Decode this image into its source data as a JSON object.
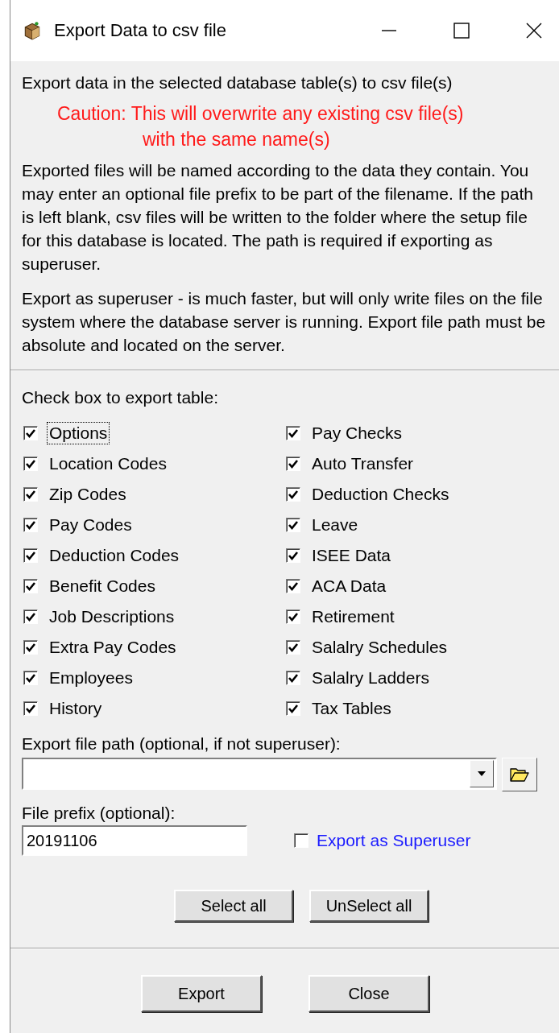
{
  "window": {
    "title": "Export Data to csv file"
  },
  "intro": "Export data in the selected database table(s) to csv file(s)",
  "caution": [
    "Caution: This will overwrite any existing csv file(s)",
    "with the same name(s)"
  ],
  "paragraphs": [
    "Exported files will be named according to the data they contain. You may enter an optional file prefix to be part of the filename. If the path is left blank, csv files will be written to the folder where the setup file for this database is located. The path is required if exporting as superuser.",
    "Export as superuser - is much faster, but will only write files on the file system where the database server is running. Export file path must be absolute and located on the server."
  ],
  "tables_label": "Check box to export table:",
  "tables": [
    {
      "label": "Options",
      "checked": true,
      "focused": true
    },
    {
      "label": "Location Codes",
      "checked": true,
      "focused": false
    },
    {
      "label": "Zip Codes",
      "checked": true,
      "focused": false
    },
    {
      "label": "Pay Codes",
      "checked": true,
      "focused": false
    },
    {
      "label": "Deduction Codes",
      "checked": true,
      "focused": false
    },
    {
      "label": "Benefit Codes",
      "checked": true,
      "focused": false
    },
    {
      "label": "Job Descriptions",
      "checked": true,
      "focused": false
    },
    {
      "label": "Extra Pay Codes",
      "checked": true,
      "focused": false
    },
    {
      "label": "Employees",
      "checked": true,
      "focused": false
    },
    {
      "label": "History",
      "checked": true,
      "focused": false
    },
    {
      "label": "Pay Checks",
      "checked": true,
      "focused": false
    },
    {
      "label": "Auto Transfer",
      "checked": true,
      "focused": false
    },
    {
      "label": "Deduction Checks",
      "checked": true,
      "focused": false
    },
    {
      "label": "Leave",
      "checked": true,
      "focused": false
    },
    {
      "label": "ISEE Data",
      "checked": true,
      "focused": false
    },
    {
      "label": "ACA Data",
      "checked": true,
      "focused": false
    },
    {
      "label": "Retirement",
      "checked": true,
      "focused": false
    },
    {
      "label": "Salalry Schedules",
      "checked": true,
      "focused": false
    },
    {
      "label": "Salalry Ladders",
      "checked": true,
      "focused": false
    },
    {
      "label": "Tax Tables",
      "checked": true,
      "focused": false
    }
  ],
  "path_label": "Export file path (optional, if not superuser):",
  "prefix_label": "File prefix (optional):",
  "prefix_value": "20191106",
  "superuser": {
    "label": "Export as Superuser",
    "checked": false
  },
  "select_buttons": [
    "Select all",
    "UnSelect all"
  ],
  "footer_buttons": [
    "Export",
    "Close"
  ]
}
